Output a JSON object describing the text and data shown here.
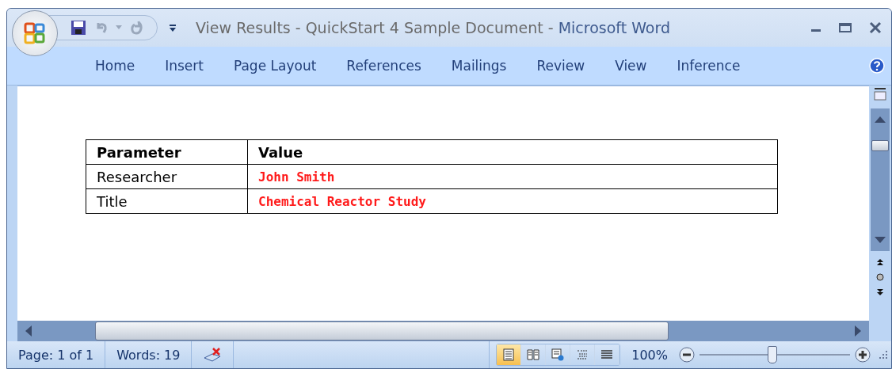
{
  "window": {
    "document_title": "View Results - QuickStart 4 Sample Document",
    "separator": "-",
    "app_name": "Microsoft Word"
  },
  "ribbon_tabs": [
    {
      "label": "Home",
      "selected": false
    },
    {
      "label": "Insert",
      "selected": false
    },
    {
      "label": "Page Layout",
      "selected": false
    },
    {
      "label": "References",
      "selected": false
    },
    {
      "label": "Mailings",
      "selected": false
    },
    {
      "label": "Review",
      "selected": false
    },
    {
      "label": "View",
      "selected": false
    },
    {
      "label": "Inference",
      "selected": false
    }
  ],
  "table": {
    "columns": [
      "Parameter",
      "Value"
    ],
    "rows": [
      [
        "Researcher",
        "John Smith"
      ],
      [
        "Title",
        "Chemical Reactor Study"
      ]
    ]
  },
  "status_bar": {
    "page": "Page: 1 of 1",
    "words": "Words: 19",
    "views": [
      {
        "kind": "print",
        "selected": true
      },
      {
        "kind": "reading",
        "selected": false
      },
      {
        "kind": "web",
        "selected": false
      },
      {
        "kind": "outline",
        "selected": false
      },
      {
        "kind": "draft",
        "selected": false
      }
    ],
    "zoom": "100%",
    "zoom_level": {
      "level": 0.48
    }
  }
}
